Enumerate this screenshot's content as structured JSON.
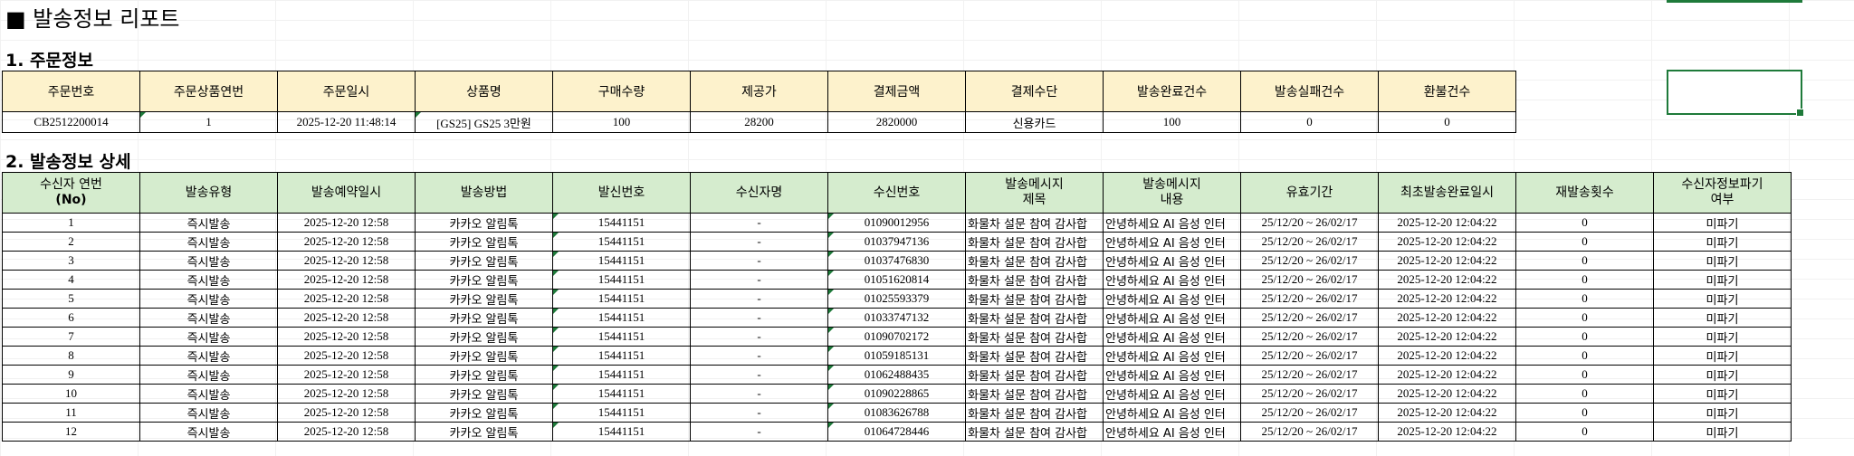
{
  "report_title": "■ 발송정보 리포트",
  "section1_title": "1. 주문정보",
  "section2_title": "2. 발송정보 상세",
  "order": {
    "headers": [
      "주문번호",
      "주문상품연번",
      "주문일시",
      "상품명",
      "구매수량",
      "제공가",
      "결제금액",
      "결제수단",
      "발송완료건수",
      "발송실패건수",
      "환불건수"
    ],
    "row": [
      "CB2512200014",
      "1",
      "2025-12-20 11:48:14",
      "[GS25] GS25 3만원",
      "100",
      "28200",
      "2820000",
      "신용카드",
      "100",
      "0",
      "0"
    ]
  },
  "detail": {
    "headers": [
      [
        "수신자 연번",
        "(No)"
      ],
      [
        "발송유형"
      ],
      [
        "발송예약일시"
      ],
      [
        "발송방법"
      ],
      [
        "발신번호"
      ],
      [
        "수신자명"
      ],
      [
        "수신번호"
      ],
      [
        "발송메시지",
        "제목"
      ],
      [
        "발송메시지",
        "내용"
      ],
      [
        "유효기간"
      ],
      [
        "최초발송완료일시"
      ],
      [
        "재발송횟수"
      ],
      [
        "수신자정보파기",
        "여부"
      ]
    ],
    "rows": [
      [
        "1",
        "즉시발송",
        "2025-12-20 12:58",
        "카카오 알림톡",
        "15441151",
        "-",
        "01090012956",
        "화물차 설문 참여 감사합",
        "안녕하세요 AI 음성 인터",
        "25/12/20 ~ 26/02/17",
        "2025-12-20 12:04:22",
        "0",
        "미파기"
      ],
      [
        "2",
        "즉시발송",
        "2025-12-20 12:58",
        "카카오 알림톡",
        "15441151",
        "-",
        "01037947136",
        "화물차 설문 참여 감사합",
        "안녕하세요 AI 음성 인터",
        "25/12/20 ~ 26/02/17",
        "2025-12-20 12:04:22",
        "0",
        "미파기"
      ],
      [
        "3",
        "즉시발송",
        "2025-12-20 12:58",
        "카카오 알림톡",
        "15441151",
        "-",
        "01037476830",
        "화물차 설문 참여 감사합",
        "안녕하세요 AI 음성 인터",
        "25/12/20 ~ 26/02/17",
        "2025-12-20 12:04:22",
        "0",
        "미파기"
      ],
      [
        "4",
        "즉시발송",
        "2025-12-20 12:58",
        "카카오 알림톡",
        "15441151",
        "-",
        "01051620814",
        "화물차 설문 참여 감사합",
        "안녕하세요 AI 음성 인터",
        "25/12/20 ~ 26/02/17",
        "2025-12-20 12:04:22",
        "0",
        "미파기"
      ],
      [
        "5",
        "즉시발송",
        "2025-12-20 12:58",
        "카카오 알림톡",
        "15441151",
        "-",
        "01025593379",
        "화물차 설문 참여 감사합",
        "안녕하세요 AI 음성 인터",
        "25/12/20 ~ 26/02/17",
        "2025-12-20 12:04:22",
        "0",
        "미파기"
      ],
      [
        "6",
        "즉시발송",
        "2025-12-20 12:58",
        "카카오 알림톡",
        "15441151",
        "-",
        "01033747132",
        "화물차 설문 참여 감사합",
        "안녕하세요 AI 음성 인터",
        "25/12/20 ~ 26/02/17",
        "2025-12-20 12:04:22",
        "0",
        "미파기"
      ],
      [
        "7",
        "즉시발송",
        "2025-12-20 12:58",
        "카카오 알림톡",
        "15441151",
        "-",
        "01090702172",
        "화물차 설문 참여 감사합",
        "안녕하세요 AI 음성 인터",
        "25/12/20 ~ 26/02/17",
        "2025-12-20 12:04:22",
        "0",
        "미파기"
      ],
      [
        "8",
        "즉시발송",
        "2025-12-20 12:58",
        "카카오 알림톡",
        "15441151",
        "-",
        "01059185131",
        "화물차 설문 참여 감사합",
        "안녕하세요 AI 음성 인터",
        "25/12/20 ~ 26/02/17",
        "2025-12-20 12:04:22",
        "0",
        "미파기"
      ],
      [
        "9",
        "즉시발송",
        "2025-12-20 12:58",
        "카카오 알림톡",
        "15441151",
        "-",
        "01062488435",
        "화물차 설문 참여 감사합",
        "안녕하세요 AI 음성 인터",
        "25/12/20 ~ 26/02/17",
        "2025-12-20 12:04:22",
        "0",
        "미파기"
      ],
      [
        "10",
        "즉시발송",
        "2025-12-20 12:58",
        "카카오 알림톡",
        "15441151",
        "-",
        "01090228865",
        "화물차 설문 참여 감사합",
        "안녕하세요 AI 음성 인터",
        "25/12/20 ~ 26/02/17",
        "2025-12-20 12:04:22",
        "0",
        "미파기"
      ],
      [
        "11",
        "즉시발송",
        "2025-12-20 12:58",
        "카카오 알림톡",
        "15441151",
        "-",
        "01083626788",
        "화물차 설문 참여 감사합",
        "안녕하세요 AI 음성 인터",
        "25/12/20 ~ 26/02/17",
        "2025-12-20 12:04:22",
        "0",
        "미파기"
      ],
      [
        "12",
        "즉시발송",
        "2025-12-20 12:58",
        "카카오 알림톡",
        "15441151",
        "-",
        "01064728446",
        "화물차 설문 참여 감사합",
        "안녕하세요 AI 음성 인터",
        "25/12/20 ~ 26/02/17",
        "2025-12-20 12:04:22",
        "0",
        "미파기"
      ]
    ]
  },
  "colors": {
    "order_header_bg": "#fdf2cc",
    "detail_header_bg": "#d5ecce",
    "selection": "#1e7a3a"
  }
}
